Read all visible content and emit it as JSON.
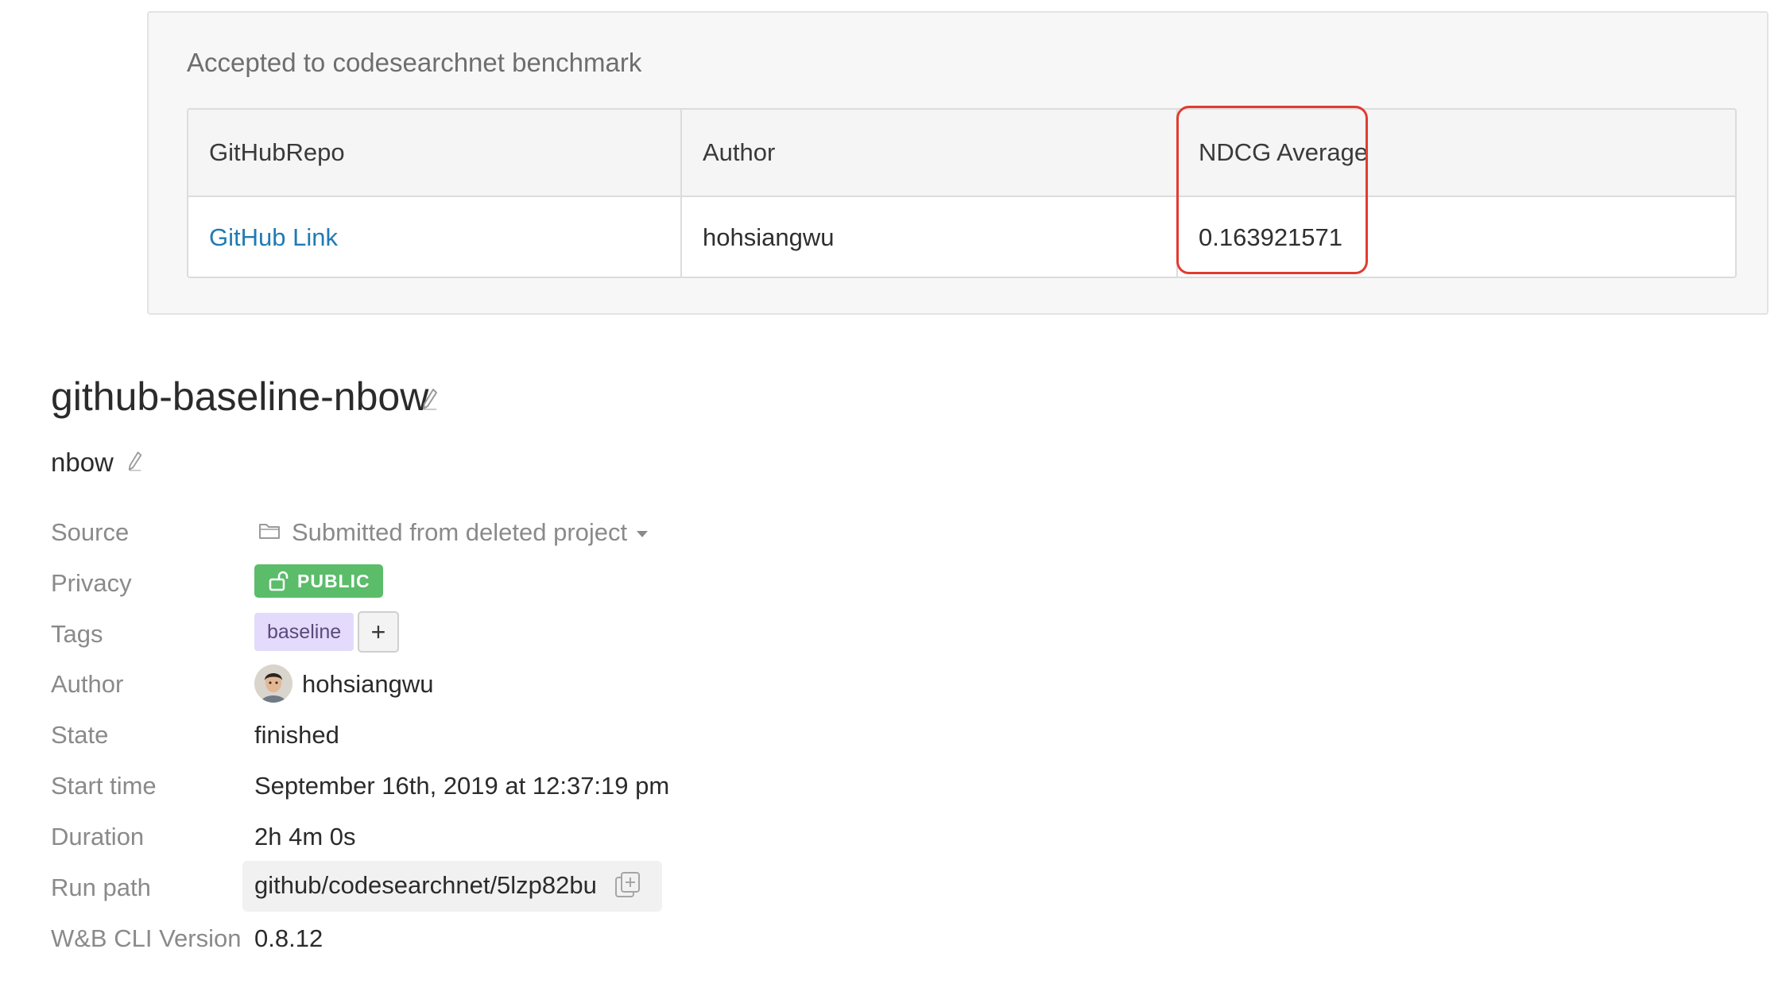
{
  "benchmark": {
    "title": "Accepted to codesearchnet benchmark",
    "columns": [
      "GitHubRepo",
      "Author",
      "NDCG Average"
    ],
    "row": {
      "repo_link": "GitHub Link",
      "author": "hohsiangwu",
      "ndcg_average": "0.163921571"
    },
    "highlight_color": "#e23b2f"
  },
  "run": {
    "name": "github-baseline-nbow",
    "group": "nbow"
  },
  "info": {
    "labels": {
      "source": "Source",
      "privacy": "Privacy",
      "tags": "Tags",
      "author": "Author",
      "state": "State",
      "start_time": "Start time",
      "duration": "Duration",
      "run_path": "Run path",
      "cli_version": "W&B CLI Version"
    },
    "source": "Submitted from deleted project",
    "privacy": "PUBLIC",
    "tags": [
      "baseline"
    ],
    "add_tag": "+",
    "author": "hohsiangwu",
    "state": "finished",
    "start_time": "September 16th, 2019 at 12:37:19 pm",
    "duration": "2h 4m 0s",
    "run_path": "github/codesearchnet/5lzp82bu",
    "cli_version": "0.8.12"
  },
  "colors": {
    "link": "#1f7bb4",
    "public_badge": "#5bbc6a",
    "tag_chip": "#e4dafc"
  },
  "icons": [
    "pencil-icon",
    "folder-icon",
    "caret-down-icon",
    "unlock-icon",
    "copy-icon",
    "avatar"
  ]
}
